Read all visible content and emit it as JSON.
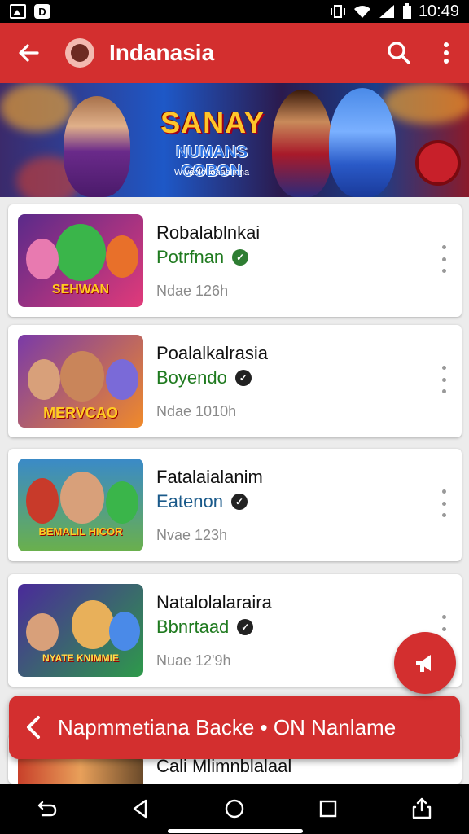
{
  "status_bar": {
    "time": "10:49"
  },
  "app_bar": {
    "title": "Indanasia"
  },
  "banner": {
    "title": "SANAY",
    "subtitle": "NUMANS COBON",
    "tagline": "Wwaolo loaaalinna"
  },
  "list": [
    {
      "title": "Robalablnkai",
      "subtitle": "Potrfnan",
      "meta": "Ndae 126h",
      "thumb_label": "SEHWAN",
      "verify_icon": "check-circle-icon",
      "colors": [
        "#5a2a8a",
        "#e13a7a"
      ]
    },
    {
      "title": "Poalalkalrasia",
      "subtitle": "Boyendo",
      "meta": "Ndae 1010h",
      "thumb_label": "MERVCAO",
      "verify_icon": "check-circle-icon",
      "colors": [
        "#7a3aa8",
        "#f08a2a"
      ]
    },
    {
      "title": "Fatalaialanim",
      "subtitle": "Eatenon",
      "meta": "Nvae 123h",
      "thumb_label": "BEMALIL HICOR",
      "verify_icon": "check-circle-icon",
      "colors": [
        "#3a8ac8",
        "#6ab04c"
      ]
    },
    {
      "title": "Natalolalaraira",
      "subtitle": "Bbnrtaad",
      "meta": "Nuae 12'9h",
      "thumb_label": "NYATE KNIMMIE",
      "verify_icon": "check-circle-icon",
      "colors": [
        "#4a2a9a",
        "#2e9a4a"
      ]
    }
  ],
  "partial_item": {
    "title": "Cali Mlimnblalaal"
  },
  "snackbar": {
    "text": "Napmmetiana Backe • ON Nanlame"
  },
  "colors": {
    "primary": "#d32f2f",
    "subtitle_green": "#1f7a1f"
  }
}
